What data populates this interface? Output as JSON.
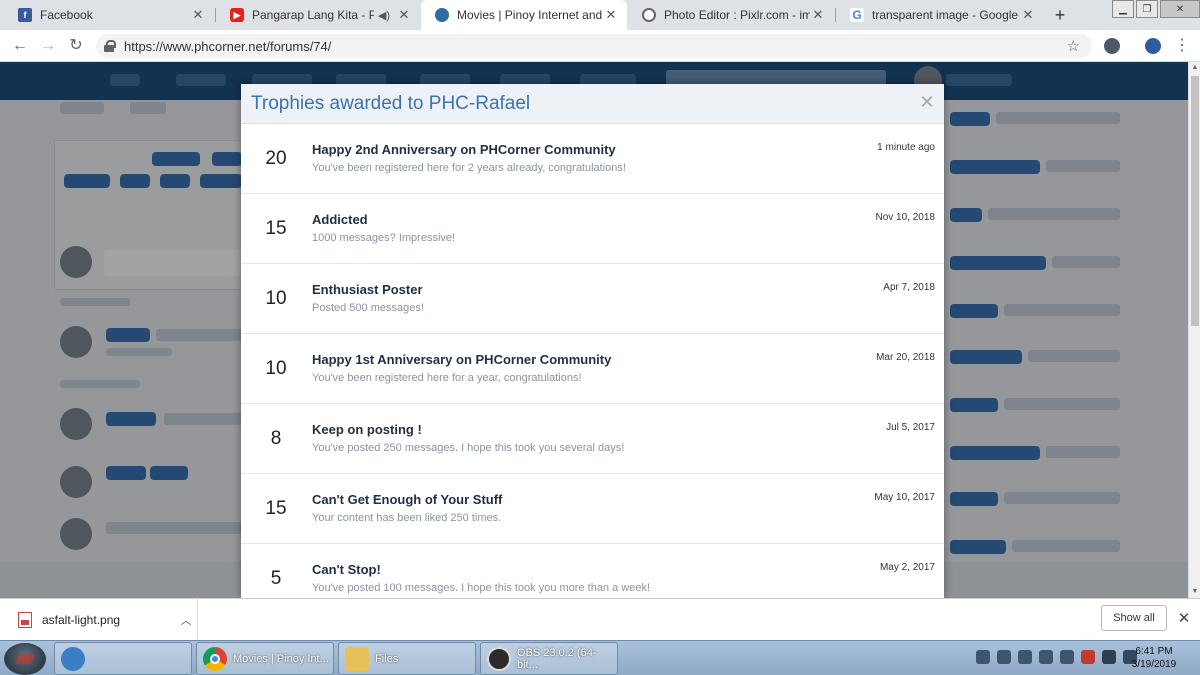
{
  "browser": {
    "tabs": [
      {
        "label": "Facebook",
        "icon": "facebook-icon"
      },
      {
        "label": "Pangarap Lang Kita - Paroky",
        "icon": "youtube-icon",
        "audio": true
      },
      {
        "label": "Movies | Pinoy Internet and Tech",
        "icon": "phcorner-icon",
        "active": true
      },
      {
        "label": "Photo Editor : Pixlr.com - image",
        "icon": "pixlr-icon"
      },
      {
        "label": "transparent image - Google Sear",
        "icon": "google-icon"
      }
    ],
    "favicon_letters": {
      "facebook": "f",
      "youtube": "▶",
      "google": "G"
    },
    "url": "https://www.phcorner.net/forums/74/"
  },
  "overlay": {
    "title": "Trophies awarded to PHC-Rafael",
    "close_label": "✕",
    "trophies": [
      {
        "points": "20",
        "title": "Happy 2nd Anniversary on PHCorner Community",
        "description": "You've been registered here for 2 years already, congratulations!",
        "date": "1 minute ago"
      },
      {
        "points": "15",
        "title": "Addicted",
        "description": "1000 messages? Impressive!",
        "date": "Nov 10, 2018"
      },
      {
        "points": "10",
        "title": "Enthusiast Poster",
        "description": "Posted 500 messages!",
        "date": "Apr 7, 2018"
      },
      {
        "points": "10",
        "title": "Happy 1st Anniversary on PHCorner Community",
        "description": "You've been registered here for a year, congratulations!",
        "date": "Mar 20, 2018"
      },
      {
        "points": "8",
        "title": "Keep on posting !",
        "description": "You've posted 250 messages. I hope this took you several days!",
        "date": "Jul 5, 2017"
      },
      {
        "points": "15",
        "title": "Can't Get Enough of Your Stuff",
        "description": "Your content has been liked 250 times.",
        "date": "May 10, 2017"
      },
      {
        "points": "5",
        "title": "Can't Stop!",
        "description": "You've posted 100 messages. I hope this took you more than a week!",
        "date": "May 2, 2017"
      }
    ]
  },
  "downloads": {
    "file_name": "asfalt-light.png",
    "show_all_label": "Show all"
  },
  "taskbar": {
    "buttons": [
      {
        "label": "Movies | Pinoy Int...",
        "icon": "chrome-icon"
      },
      {
        "label": "Files",
        "icon": "folder-icon"
      },
      {
        "label": "OBS 23.0.2 (64-bit...",
        "icon": "obs-icon"
      }
    ],
    "time": "6:41 PM",
    "date": "3/19/2019"
  }
}
